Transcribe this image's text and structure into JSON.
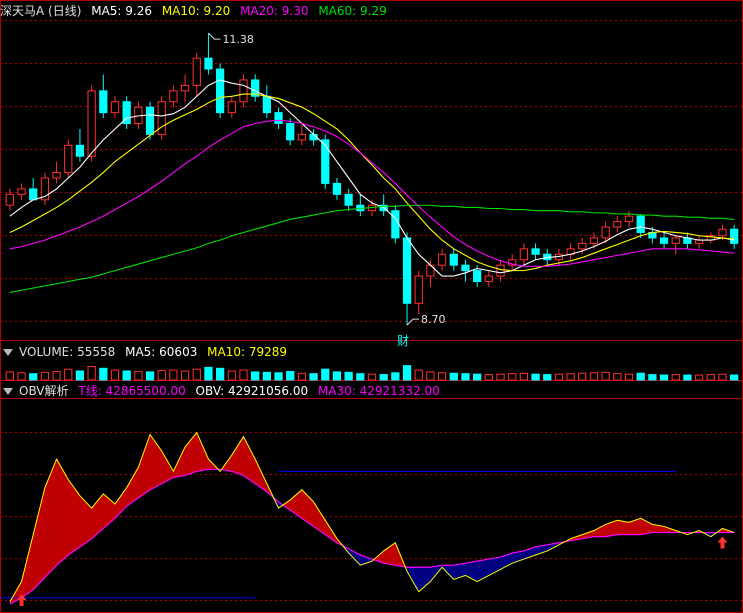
{
  "main_panel": {
    "title": "深天马A (日线)",
    "indicators": [
      {
        "label": "MA5: 9.26",
        "color": "#ffffff"
      },
      {
        "label": "MA10: 9.20",
        "color": "#ffff00"
      },
      {
        "label": "MA20: 9.30",
        "color": "#ff00ff"
      },
      {
        "label": "MA60: 9.29",
        "color": "#00e000"
      }
    ],
    "high_label": "11.38",
    "low_label": "8.70",
    "event_badge": "财"
  },
  "volume_panel": {
    "title": "VOLUME: 55558",
    "indicators": [
      {
        "label": "MA5: 60603",
        "color": "#ffffff"
      },
      {
        "label": "MA10: 79289",
        "color": "#ffff00"
      }
    ]
  },
  "obv_panel": {
    "title": "OBV解析",
    "indicators": [
      {
        "label": "T线: 42865500.00",
        "color": "#ff00ff"
      },
      {
        "label": "OBV: 42921056.00",
        "color": "#ffffff"
      },
      {
        "label": "MA30: 42921332.00",
        "color": "#ff00ff"
      }
    ]
  },
  "colors": {
    "up": "#ff3030",
    "down": "#00ffff",
    "ma5": "#ffffff",
    "ma10": "#ffff00",
    "ma20": "#ff00ff",
    "ma60": "#00e000",
    "grid": "#b40000",
    "obv_up_fill": "#c00000",
    "obv_down_fill": "#000080",
    "obv_line": "#ffff00",
    "obv_ma": "#ff00ff",
    "ref_line": "#0000ff",
    "signal": "#ff3030"
  },
  "chart_data": [
    {
      "type": "candlestick",
      "title": "深天马A (日线)",
      "ylim": [
        8.6,
        11.5
      ],
      "high": 11.38,
      "low": 8.7,
      "ohlc": [
        [
          9.8,
          9.95,
          9.75,
          9.9
        ],
        [
          9.9,
          10.0,
          9.85,
          9.95
        ],
        [
          9.95,
          10.05,
          9.9,
          9.85
        ],
        [
          9.85,
          10.1,
          9.8,
          10.05
        ],
        [
          10.05,
          10.2,
          10.0,
          10.1
        ],
        [
          10.1,
          10.4,
          10.05,
          10.35
        ],
        [
          10.35,
          10.5,
          10.2,
          10.25
        ],
        [
          10.25,
          10.9,
          10.2,
          10.85
        ],
        [
          10.85,
          11.0,
          10.6,
          10.65
        ],
        [
          10.65,
          10.8,
          10.6,
          10.75
        ],
        [
          10.75,
          10.8,
          10.5,
          10.55
        ],
        [
          10.55,
          10.75,
          10.5,
          10.7
        ],
        [
          10.7,
          10.75,
          10.4,
          10.45
        ],
        [
          10.45,
          10.8,
          10.4,
          10.75
        ],
        [
          10.75,
          10.9,
          10.7,
          10.85
        ],
        [
          10.85,
          11.0,
          10.75,
          10.9
        ],
        [
          10.9,
          11.2,
          10.8,
          11.15
        ],
        [
          11.15,
          11.38,
          11.0,
          11.05
        ],
        [
          11.05,
          11.1,
          10.6,
          10.65
        ],
        [
          10.65,
          10.8,
          10.6,
          10.75
        ],
        [
          10.75,
          11.0,
          10.7,
          10.95
        ],
        [
          10.95,
          11.0,
          10.75,
          10.8
        ],
        [
          10.8,
          10.9,
          10.6,
          10.65
        ],
        [
          10.65,
          10.7,
          10.5,
          10.55
        ],
        [
          10.55,
          10.6,
          10.35,
          10.4
        ],
        [
          10.4,
          10.55,
          10.35,
          10.45
        ],
        [
          10.45,
          10.5,
          10.35,
          10.4
        ],
        [
          10.4,
          10.45,
          9.95,
          10.0
        ],
        [
          10.0,
          10.05,
          9.85,
          9.9
        ],
        [
          9.9,
          9.95,
          9.75,
          9.8
        ],
        [
          9.8,
          9.9,
          9.7,
          9.75
        ],
        [
          9.75,
          9.85,
          9.7,
          9.8
        ],
        [
          9.8,
          9.9,
          9.7,
          9.75
        ],
        [
          9.75,
          9.8,
          9.45,
          9.5
        ],
        [
          9.5,
          9.55,
          8.7,
          8.9
        ],
        [
          8.9,
          9.2,
          8.8,
          9.15
        ],
        [
          9.15,
          9.3,
          9.05,
          9.25
        ],
        [
          9.25,
          9.4,
          9.2,
          9.35
        ],
        [
          9.35,
          9.4,
          9.2,
          9.25
        ],
        [
          9.25,
          9.3,
          9.1,
          9.2
        ],
        [
          9.2,
          9.25,
          9.05,
          9.1
        ],
        [
          9.1,
          9.2,
          9.05,
          9.15
        ],
        [
          9.15,
          9.3,
          9.1,
          9.25
        ],
        [
          9.25,
          9.35,
          9.2,
          9.3
        ],
        [
          9.3,
          9.45,
          9.25,
          9.4
        ],
        [
          9.4,
          9.45,
          9.3,
          9.35
        ],
        [
          9.35,
          9.4,
          9.25,
          9.3
        ],
        [
          9.3,
          9.4,
          9.25,
          9.35
        ],
        [
          9.35,
          9.45,
          9.3,
          9.4
        ],
        [
          9.4,
          9.5,
          9.35,
          9.45
        ],
        [
          9.45,
          9.55,
          9.4,
          9.5
        ],
        [
          9.5,
          9.65,
          9.45,
          9.6
        ],
        [
          9.6,
          9.7,
          9.55,
          9.65
        ],
        [
          9.65,
          9.75,
          9.6,
          9.7
        ],
        [
          9.7,
          9.72,
          9.5,
          9.55
        ],
        [
          9.55,
          9.6,
          9.45,
          9.5
        ],
        [
          9.5,
          9.55,
          9.4,
          9.45
        ],
        [
          9.45,
          9.52,
          9.35,
          9.5
        ],
        [
          9.5,
          9.55,
          9.4,
          9.45
        ],
        [
          9.45,
          9.52,
          9.4,
          9.48
        ],
        [
          9.48,
          9.55,
          9.45,
          9.52
        ],
        [
          9.52,
          9.62,
          9.48,
          9.58
        ],
        [
          9.58,
          9.62,
          9.4,
          9.45
        ]
      ],
      "ma5": [
        9.7,
        9.78,
        9.85,
        9.88,
        9.95,
        10.05,
        10.15,
        10.28,
        10.4,
        10.5,
        10.6,
        10.62,
        10.63,
        10.62,
        10.64,
        10.7,
        10.8,
        10.9,
        10.95,
        10.92,
        10.9,
        10.85,
        10.8,
        10.75,
        10.65,
        10.55,
        10.45,
        10.35,
        10.2,
        10.05,
        9.9,
        9.82,
        9.78,
        9.68,
        9.5,
        9.35,
        9.25,
        9.15,
        9.15,
        9.18,
        9.22,
        9.2,
        9.18,
        9.2,
        9.25,
        9.3,
        9.32,
        9.33,
        9.35,
        9.38,
        9.42,
        9.47,
        9.53,
        9.58,
        9.6,
        9.58,
        9.55,
        9.52,
        9.5,
        9.48,
        9.48,
        9.5,
        9.48
      ],
      "ma10": [
        9.55,
        9.6,
        9.66,
        9.72,
        9.78,
        9.85,
        9.93,
        10.01,
        10.1,
        10.2,
        10.28,
        10.36,
        10.44,
        10.52,
        10.58,
        10.63,
        10.68,
        10.74,
        10.79,
        10.8,
        10.82,
        10.82,
        10.8,
        10.78,
        10.74,
        10.7,
        10.64,
        10.57,
        10.5,
        10.4,
        10.28,
        10.17,
        10.05,
        9.95,
        9.82,
        9.7,
        9.58,
        9.48,
        9.4,
        9.34,
        9.28,
        9.24,
        9.21,
        9.2,
        9.2,
        9.22,
        9.25,
        9.27,
        9.29,
        9.32,
        9.36,
        9.4,
        9.44,
        9.48,
        9.52,
        9.55,
        9.56,
        9.55,
        9.54,
        9.52,
        9.51,
        9.5,
        9.49
      ],
      "ma20": [
        9.4,
        9.42,
        9.45,
        9.48,
        9.52,
        9.56,
        9.6,
        9.65,
        9.7,
        9.76,
        9.82,
        9.88,
        9.95,
        10.02,
        10.1,
        10.18,
        10.25,
        10.33,
        10.4,
        10.46,
        10.52,
        10.55,
        10.57,
        10.58,
        10.57,
        10.55,
        10.52,
        10.48,
        10.43,
        10.36,
        10.28,
        10.19,
        10.1,
        10.0,
        9.89,
        9.79,
        9.69,
        9.6,
        9.51,
        9.44,
        9.38,
        9.33,
        9.29,
        9.26,
        9.24,
        9.24,
        9.24,
        9.25,
        9.26,
        9.28,
        9.3,
        9.32,
        9.34,
        9.36,
        9.38,
        9.4,
        9.4,
        9.4,
        9.4,
        9.39,
        9.38,
        9.37,
        9.36
      ],
      "ma60": [
        9.0,
        9.02,
        9.04,
        9.06,
        9.08,
        9.1,
        9.12,
        9.14,
        9.17,
        9.2,
        9.23,
        9.26,
        9.29,
        9.32,
        9.35,
        9.38,
        9.41,
        9.45,
        9.48,
        9.52,
        9.55,
        9.58,
        9.61,
        9.64,
        9.67,
        9.69,
        9.71,
        9.73,
        9.75,
        9.76,
        9.77,
        9.78,
        9.79,
        9.79,
        9.8,
        9.8,
        9.8,
        9.79,
        9.79,
        9.78,
        9.78,
        9.77,
        9.77,
        9.76,
        9.76,
        9.75,
        9.75,
        9.75,
        9.74,
        9.74,
        9.73,
        9.73,
        9.72,
        9.72,
        9.71,
        9.71,
        9.7,
        9.7,
        9.69,
        9.69,
        9.68,
        9.68,
        9.67
      ]
    },
    {
      "type": "bar",
      "title": "VOLUME: 55558",
      "ylim": [
        0,
        200000
      ],
      "values": [
        90000,
        80000,
        70000,
        85000,
        95000,
        120000,
        100000,
        150000,
        130000,
        110000,
        100000,
        95000,
        90000,
        105000,
        110000,
        100000,
        120000,
        140000,
        130000,
        100000,
        110000,
        90000,
        85000,
        80000,
        95000,
        75000,
        70000,
        120000,
        90000,
        85000,
        70000,
        65000,
        60000,
        80000,
        160000,
        110000,
        90000,
        80000,
        75000,
        70000,
        65000,
        60000,
        65000,
        70000,
        75000,
        65000,
        60000,
        65000,
        70000,
        75000,
        80000,
        85000,
        70000,
        65000,
        75000,
        60000,
        55000,
        60000,
        55000,
        55000,
        60000,
        65000,
        55558
      ],
      "ma5": 60603,
      "ma10": 79289
    },
    {
      "type": "area",
      "title": "OBV解析",
      "ylim": [
        0,
        100
      ],
      "obv": [
        2,
        12,
        35,
        58,
        72,
        62,
        54,
        48,
        55,
        50,
        58,
        68,
        84,
        76,
        66,
        78,
        85,
        72,
        66,
        74,
        83,
        72,
        60,
        48,
        52,
        57,
        51,
        42,
        33,
        26,
        20,
        22,
        27,
        31,
        17,
        7,
        12,
        19,
        13,
        15,
        12,
        15,
        18,
        21,
        23,
        25,
        27,
        30,
        33,
        35,
        37,
        40,
        42,
        41,
        43,
        40,
        39,
        37,
        35,
        37,
        34,
        38,
        36
      ],
      "ma30": [
        1,
        4,
        8,
        14,
        20,
        25,
        29,
        33,
        38,
        43,
        49,
        53,
        57,
        60,
        63,
        64,
        66,
        67,
        67,
        66,
        64,
        60,
        56,
        51,
        47,
        43,
        39,
        35,
        31,
        28,
        25,
        23,
        21,
        20,
        19,
        19,
        19,
        20,
        20,
        21,
        22,
        23,
        24,
        26,
        27,
        29,
        30,
        31,
        32,
        33,
        34,
        34,
        35,
        35,
        35,
        36,
        36,
        36,
        36,
        36,
        36,
        36,
        36
      ],
      "signals": [
        1,
        61
      ]
    }
  ]
}
